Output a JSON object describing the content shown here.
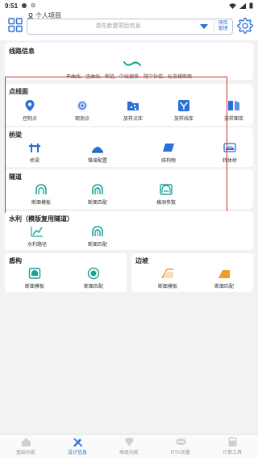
{
  "status_bar": {
    "time": "9:51"
  },
  "header": {
    "project_title": "个人项目",
    "search_placeholder": "请先新建项目信息",
    "manage_button_line1": "项目",
    "manage_button_line2": "管理"
  },
  "route_info": {
    "title": "线路信息",
    "description": "平曲线、竖曲线、断链、中线偏移、隧中补偿、标准横断面"
  },
  "point_survey": {
    "title": "点线面",
    "items": [
      {
        "label": "控制点",
        "icon": "location-pin-icon"
      },
      {
        "label": "观测点",
        "icon": "target-icon"
      },
      {
        "label": "放样点库",
        "icon": "point-library-icon"
      },
      {
        "label": "放样线库",
        "icon": "line-library-icon"
      },
      {
        "label": "放样面库",
        "icon": "surface-library-icon"
      }
    ]
  },
  "bridge": {
    "title": "桥梁",
    "items": [
      {
        "label": "桥梁",
        "icon": "bridge-icon"
      },
      {
        "label": "锥坡配置",
        "icon": "cone-slope-icon"
      },
      {
        "label": "结构物",
        "icon": "structure-icon"
      },
      {
        "label": "转体桥",
        "icon": "swivel-bridge-icon"
      }
    ]
  },
  "tunnel": {
    "title": "隧道",
    "items": [
      {
        "label": "断面模板",
        "icon": "section-template-icon"
      },
      {
        "label": "断面匹配",
        "icon": "section-match-icon"
      },
      {
        "label": "横洞参数",
        "icon": "cross-tunnel-icon"
      }
    ]
  },
  "hydraulic": {
    "title": "水利（模版复用隧道）",
    "items": [
      {
        "label": "水利路径",
        "icon": "water-route-icon"
      },
      {
        "label": "断面匹配",
        "icon": "section-match-icon"
      }
    ]
  },
  "shield": {
    "title": "盾构",
    "items": [
      {
        "label": "断面模板",
        "icon": "section-template-icon"
      },
      {
        "label": "断面匹配",
        "icon": "section-match-icon"
      }
    ]
  },
  "slope": {
    "title": "边坡",
    "items": [
      {
        "label": "断面模板",
        "icon": "slope-template-icon"
      },
      {
        "label": "断面匹配",
        "icon": "slope-match-icon"
      }
    ]
  },
  "tabs": [
    {
      "label": "基础功能",
      "active": false
    },
    {
      "label": "设计信息",
      "active": true
    },
    {
      "label": "高级功能",
      "active": false
    },
    {
      "label": "RTK测量",
      "active": false
    },
    {
      "label": "计算工具",
      "active": false
    }
  ],
  "colors": {
    "accent": "#2a6fd6",
    "teal": "#1aa39a",
    "orange": "#f39a2c",
    "highlight_frame": "#d92c2c"
  }
}
